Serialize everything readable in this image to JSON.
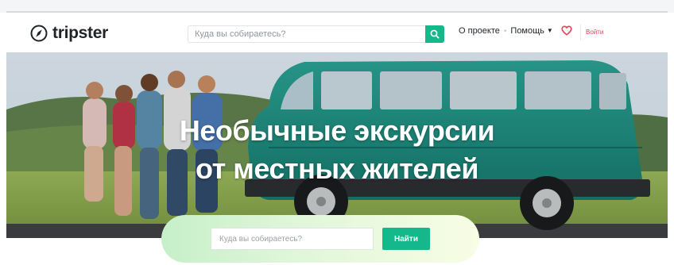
{
  "header": {
    "logo_text": "tripster",
    "search_placeholder": "Куда вы собираетесь?",
    "nav": {
      "about": "О проекте",
      "help": "Помощь",
      "login": "Войти"
    },
    "icons": {
      "logo": "compass-icon",
      "search": "search-icon",
      "help_caret": "caret-down-icon",
      "favorites": "heart-icon"
    }
  },
  "hero": {
    "title_line1": "Необычные экскурсии",
    "title_line2": "от местных жителей"
  },
  "bottom_search": {
    "placeholder": "Куда вы собираетесь?",
    "button": "Найти"
  },
  "colors": {
    "accent": "#15b88a",
    "login": "#e2445c",
    "van": "#1c8c7e",
    "text": "#1f2428"
  }
}
